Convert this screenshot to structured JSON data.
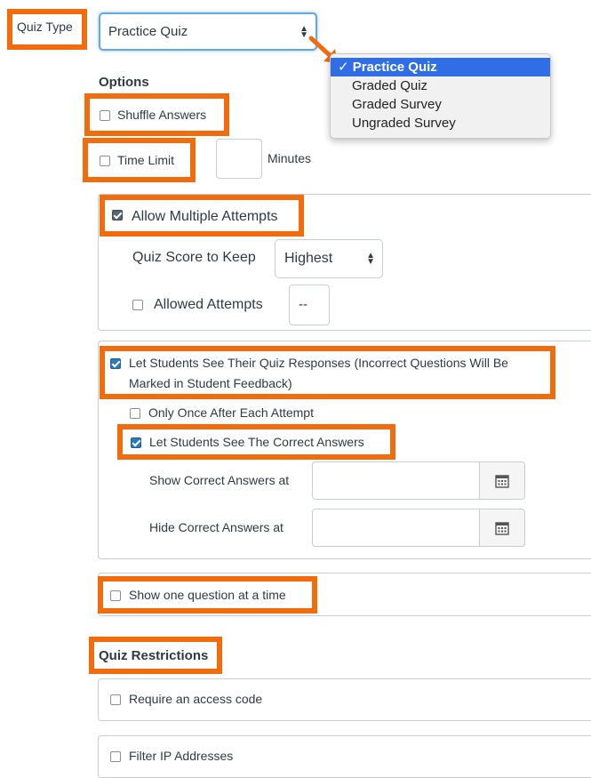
{
  "quiz_type": {
    "label": "Quiz Type",
    "selected": "Practice Quiz",
    "dropdown_options": [
      {
        "label": "Practice Quiz",
        "selected": true
      },
      {
        "label": "Graded Quiz",
        "selected": false
      },
      {
        "label": "Graded Survey",
        "selected": false
      },
      {
        "label": "Ungraded Survey",
        "selected": false
      }
    ],
    "check_mark": "✓"
  },
  "options": {
    "heading": "Options",
    "shuffle_answers": {
      "label": "Shuffle Answers",
      "checked": false
    },
    "time_limit": {
      "label": "Time Limit",
      "checked": false,
      "value": "",
      "unit": "Minutes"
    },
    "multiple_attempts": {
      "label": "Allow Multiple Attempts",
      "checked": true,
      "score_to_keep_label": "Quiz Score to Keep",
      "score_to_keep_value": "Highest",
      "allowed_attempts_label": "Allowed Attempts",
      "allowed_attempts_checked": false,
      "allowed_attempts_value": "--"
    },
    "see_responses": {
      "label_line1": "Let Students See Their Quiz Responses (Incorrect Questions Will Be",
      "label_line2": "Marked in Student Feedback)",
      "checked": true,
      "only_once": {
        "label": "Only Once After Each Attempt",
        "checked": false
      },
      "see_correct": {
        "label": "Let Students See The Correct Answers",
        "checked": true
      },
      "show_correct_at": {
        "label": "Show Correct Answers at",
        "value": ""
      },
      "hide_correct_at": {
        "label": "Hide Correct Answers at",
        "value": ""
      }
    },
    "one_question": {
      "label": "Show one question at a time",
      "checked": false
    }
  },
  "restrictions": {
    "heading": "Quiz Restrictions",
    "access_code": {
      "label": "Require an access code",
      "checked": false
    },
    "filter_ip": {
      "label": "Filter IP Addresses",
      "checked": false
    }
  },
  "colors": {
    "highlight": "#f26b0c",
    "checkbox_checked": "#2b7abc",
    "dropdown_selected": "#2f6ee6"
  },
  "icons": {
    "select_arrows": "updown-arrows-icon",
    "calendar": "calendar-icon",
    "pointer_arrow": "orange-arrow-icon"
  }
}
